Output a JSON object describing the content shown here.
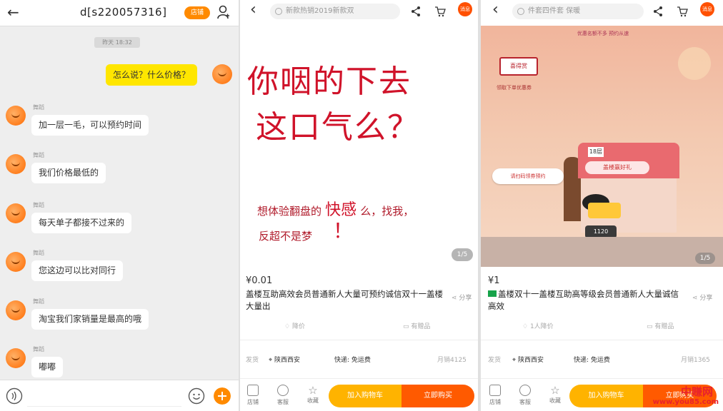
{
  "chat": {
    "back_icon": "←",
    "title": "d[s220057316]",
    "pill_label": "店铺",
    "timestamp": "昨天 18:32",
    "my_message": "怎么说？什么价格？",
    "messages": [
      {
        "sender": "舞蹈",
        "text": "加一层一毛，可以预约时间"
      },
      {
        "sender": "舞蹈",
        "text": "我们价格最低的"
      },
      {
        "sender": "舞蹈",
        "text": "每天单子都接不过来的"
      },
      {
        "sender": "舞蹈",
        "text": "您这边可以比对同行"
      },
      {
        "sender": "舞蹈",
        "text": "淘宝我们家销量是最高的哦"
      },
      {
        "sender": "舞蹈",
        "text": "嘟嘟"
      }
    ]
  },
  "product1": {
    "back_icon": "‹",
    "search_placeholder": "新款热销2019新款双",
    "badge": "消息",
    "big_line1": "你咽的下去",
    "big_line2": "这口气么？",
    "small_line1a": "想体验翻盘的",
    "small_big": "快感",
    "small_line1b": "么，找我，",
    "small_line2": "反超不是梦",
    "exclaim": "！",
    "pager": "1/5",
    "price": "¥0.01",
    "title": "盖楼互助高效会员普通新人大量可预约诚信双十一盖楼大量出",
    "share": "分享",
    "action_left": "降价",
    "action_right": "有赠品",
    "ship_from_label": "发货",
    "location": "陕西西安",
    "shipping": "快递: 免运费",
    "sales": "月销4125",
    "nav_shop": "店铺",
    "nav_service": "客服",
    "nav_fav": "收藏",
    "cart_label": "加入购物车",
    "buy_label": "立即购买"
  },
  "product2": {
    "back_icon": "‹",
    "search_placeholder": "件套四件套 保暖",
    "badge": "消息",
    "sign_label": "喜得赏",
    "sign_sub": "领取下单优惠券",
    "top_text": "优惠名额不多 预约从速",
    "pill_text": "请扫码领券预约",
    "floor_text": "18层",
    "banner_text": "盖楼赢好礼",
    "score_text": "1120",
    "pager": "1/5",
    "price": "¥1",
    "title": "盖楼双十一盖楼互助高等级会员普通新人大量诚信高效",
    "share": "分享",
    "action_left": "1人降价",
    "action_right": "有赠品",
    "ship_from_label": "发货",
    "location": "陕西西安",
    "shipping": "快递: 免运费",
    "sales": "月销1365",
    "nav_shop": "店铺",
    "nav_service": "客服",
    "nav_fav": "收藏",
    "cart_label": "加入购物车",
    "buy_label": "立即购买"
  },
  "watermark": {
    "title": "中赚网",
    "url": "www.you85.com"
  },
  "colors": {
    "orange": "#ff8a00",
    "chat_yellow": "#ffe600",
    "red_text": "#d0132a",
    "cta_left": "#ffb300",
    "cta_right": "#ff5a00"
  }
}
